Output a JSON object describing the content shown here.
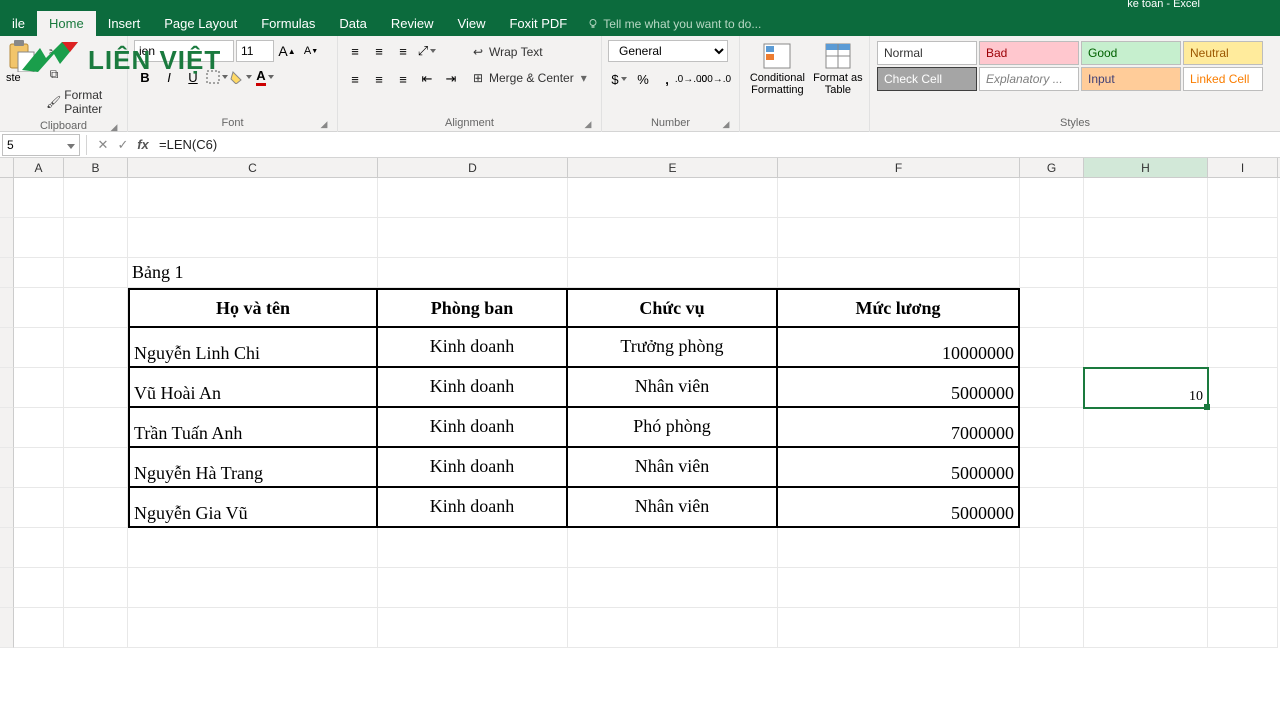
{
  "title": "ke toan - Excel",
  "tabs": {
    "file": "ile",
    "home": "Home",
    "insert": "Insert",
    "pagelayout": "Page Layout",
    "formulas": "Formulas",
    "data": "Data",
    "review": "Review",
    "view": "View",
    "foxit": "Foxit PDF"
  },
  "tellme": "Tell me what you want to do...",
  "ribbon": {
    "paste": "ste",
    "format_painter": "Format Painter",
    "clipboard": "Clipboard",
    "font_name": "ien",
    "font_size": "11",
    "font": "Font",
    "wrap": "Wrap Text",
    "merge": "Merge & Center",
    "alignment": "Alignment",
    "num_format": "General",
    "number": "Number",
    "cond": "Conditional Formatting",
    "fat": "Format as Table",
    "styles_label": "Styles",
    "styles": {
      "normal": "Normal",
      "bad": "Bad",
      "good": "Good",
      "neutral": "Neutral",
      "check": "Check Cell",
      "expl": "Explanatory ...",
      "input": "Input",
      "linked": "Linked Cell"
    }
  },
  "watermark": "LIÊN VIỆT",
  "formula_bar": {
    "name": "5",
    "formula": "=LEN(C6)"
  },
  "cols": {
    "A": "A",
    "B": "B",
    "C": "C",
    "D": "D",
    "E": "E",
    "F": "F",
    "G": "G",
    "H": "H",
    "I": "I"
  },
  "table": {
    "title": "Bảng 1",
    "h1": "Họ và tên",
    "h2": "Phòng ban",
    "h3": "Chức vụ",
    "h4": "Mức lương",
    "rows": [
      {
        "name": "Nguyễn Linh Chi",
        "dept": "Kinh doanh",
        "pos": "Trưởng phòng",
        "sal": "10000000"
      },
      {
        "name": "Vũ Hoài An",
        "dept": "Kinh doanh",
        "pos": "Nhân viên",
        "sal": "5000000"
      },
      {
        "name": "Trần Tuấn Anh",
        "dept": "Kinh doanh",
        "pos": "Phó phòng",
        "sal": "7000000"
      },
      {
        "name": "Nguyễn Hà Trang",
        "dept": "Kinh doanh",
        "pos": "Nhân viên",
        "sal": "5000000"
      },
      {
        "name": "Nguyễn Gia Vũ",
        "dept": "Kinh doanh",
        "pos": "Nhân viên",
        "sal": "5000000"
      }
    ]
  },
  "h6_value": "10"
}
